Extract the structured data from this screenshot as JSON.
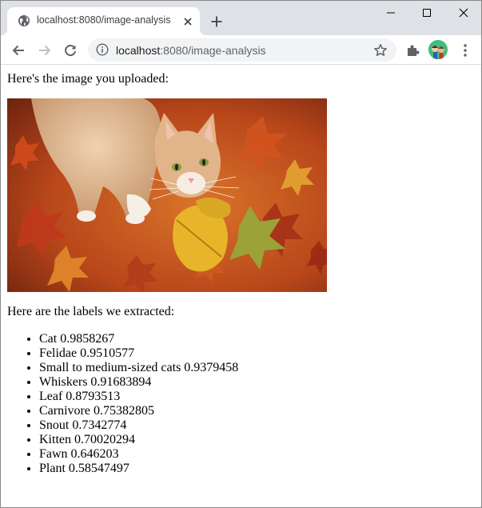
{
  "browser": {
    "tab_title": "localhost:8080/image-analysis",
    "url_host": "localhost",
    "url_path": ":8080/image-analysis",
    "icons": {
      "favicon": "globe-icon",
      "close_tab": "close-icon",
      "new_tab": "plus-icon",
      "back": "arrow-left-icon",
      "forward": "arrow-right-icon",
      "reload": "reload-icon",
      "site_info": "info-icon",
      "bookmark": "star-icon",
      "extensions": "puzzle-icon",
      "menu": "kebab-menu-icon"
    }
  },
  "page": {
    "intro": "Here's the image you uploaded:",
    "labels_heading": "Here are the labels we extracted:",
    "labels": [
      {
        "text": "Cat 0.9858267"
      },
      {
        "text": "Felidae 0.9510577"
      },
      {
        "text": "Small to medium-sized cats 0.9379458"
      },
      {
        "text": "Whiskers 0.91683894"
      },
      {
        "text": "Leaf 0.8793513"
      },
      {
        "text": "Carnivore 0.75382805"
      },
      {
        "text": "Snout 0.7342774"
      },
      {
        "text": "Kitten 0.70020294"
      },
      {
        "text": "Fawn 0.646203"
      },
      {
        "text": "Plant 0.58547497"
      }
    ]
  },
  "colors": {
    "tabstrip": "#dee1e6",
    "omnibox": "#f1f3f4",
    "avatar": "#3fbf7f"
  }
}
